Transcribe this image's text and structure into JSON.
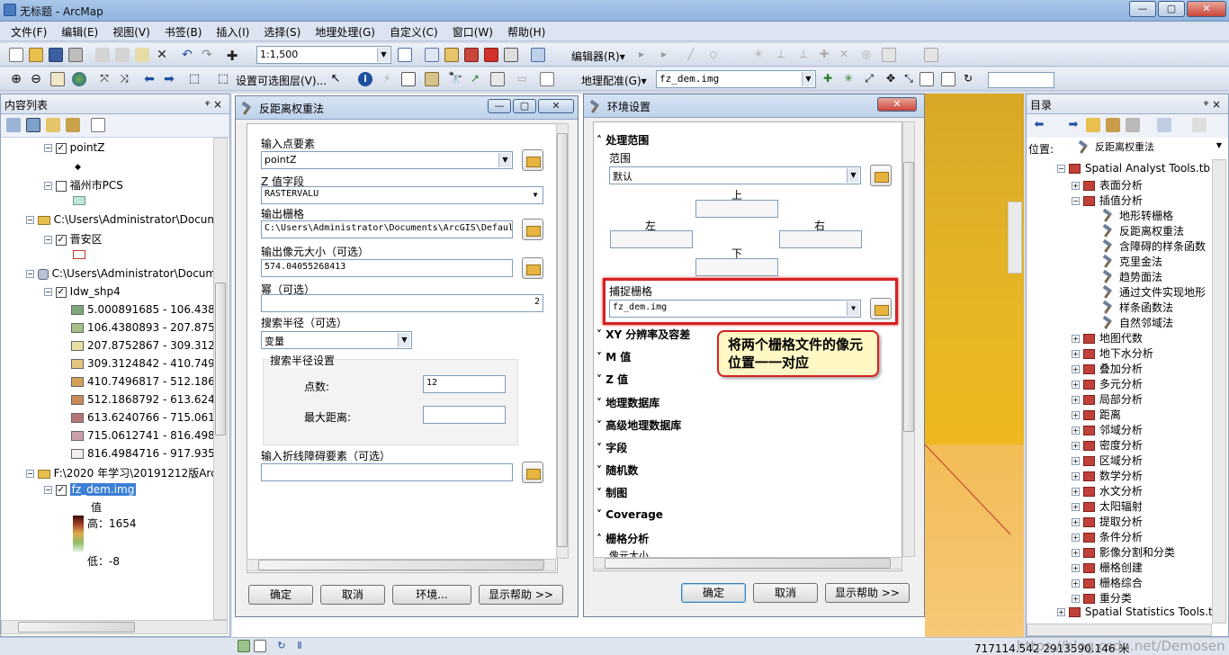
{
  "app": {
    "title": "无标题 - ArcMap"
  },
  "menu": [
    "文件(F)",
    "编辑(E)",
    "视图(V)",
    "书签(B)",
    "插入(I)",
    "选择(S)",
    "地理处理(G)",
    "自定义(C)",
    "窗口(W)",
    "帮助(H)"
  ],
  "toolbar1": {
    "scale": "1:1,500",
    "editor": "编辑器(R)▾"
  },
  "toolbar2": {
    "set_layer": "设置可选图层(V)...",
    "georef": "地理配准(G)▾",
    "georef_layer": "fz_dem.img"
  },
  "toc": {
    "title": "内容列表",
    "pin": "ᵠ ×",
    "rows": [
      "pointZ",
      "福州市PCS",
      "C:\\Users\\Administrator\\Docum",
      "晋安区",
      "C:\\Users\\Administrator\\Docum",
      "Idw_shp4",
      "F:\\2020 年学习\\20191212版Arc",
      "fz_dem.img"
    ],
    "classes": [
      {
        "label": "5.000891685 - 106.4380",
        "color": "#7fa87a"
      },
      {
        "label": "106.4380893 - 207.8752",
        "color": "#a5c185"
      },
      {
        "label": "207.8752867 - 309.3124",
        "color": "#e9dfa2"
      },
      {
        "label": "309.3124842 - 410.7496",
        "color": "#e3c580"
      },
      {
        "label": "410.7496817 - 512.1868",
        "color": "#d89f5a"
      },
      {
        "label": "512.1868792 - 613.6240",
        "color": "#c98a57"
      },
      {
        "label": "613.6240766 - 715.0612",
        "color": "#b87474"
      },
      {
        "label": "715.0612741 - 816.4984",
        "color": "#c9a0aa"
      },
      {
        "label": "816.4984716 - 917.9356",
        "color": "#f3eef0"
      }
    ],
    "value_label": "值",
    "high": "高：1654",
    "low": "低：-8"
  },
  "idw": {
    "title": "反距离权重法",
    "input_label": "输入点要素",
    "input_value": "pointZ",
    "z_label": "Z 值字段",
    "z_value": "RASTERVALU",
    "out_label": "输出栅格",
    "out_value": "C:\\Users\\Administrator\\Documents\\ArcGIS\\Defaul",
    "cell_label": "输出像元大小（可选）",
    "cell_value": "574.04055268413",
    "power_label": "幂（可选）",
    "power_value": "2",
    "radius_label": "搜索半径（可选）",
    "radius_value": "变量",
    "radius_group": "搜索半径设置",
    "points_label": "点数:",
    "points_value": "12",
    "maxdist_label": "最大距离:",
    "maxdist_value": "",
    "barrier_label": "输入折线障碍要素（可选）",
    "ok": "确定",
    "cancel": "取消",
    "env": "环境...",
    "help": "显示帮助 >>"
  },
  "env": {
    "title": "环境设置",
    "extent": "处理范围",
    "extent_label": "范围",
    "extent_value": "默认",
    "top": "上",
    "left": "左",
    "right": "右",
    "bottom": "下",
    "snap_label": "捕捉栅格",
    "snap_value": "fz_dem.img",
    "sections": [
      "XY 分辨率及容差",
      "M 值",
      "Z 值",
      "地理数据库",
      "高级地理数据库",
      "字段",
      "随机数",
      "制图",
      "Coverage",
      "栅格分析"
    ],
    "cell_size": "像元大小",
    "ok": "确定",
    "cancel": "取消",
    "help": "显示帮助 >>"
  },
  "callout": "将两个栅格文件的像元位置一一对应",
  "catalog": {
    "title": "目录",
    "location_label": "位置:",
    "location_value": "反距离权重法",
    "toolbox": "Spatial Analyst Tools.tb",
    "surface": "表面分析",
    "interp": "插值分析",
    "tools": [
      "地形转栅格",
      "反距离权重法",
      "含障碍的样条函数",
      "克里金法",
      "趋势面法",
      "通过文件实现地形",
      "样条函数法",
      "自然邻域法"
    ],
    "sets": [
      "地图代数",
      "地下水分析",
      "叠加分析",
      "多元分析",
      "局部分析",
      "距离",
      "邻域分析",
      "密度分析",
      "区域分析",
      "数学分析",
      "水文分析",
      "太阳辐射",
      "提取分析",
      "条件分析",
      "影像分割和分类",
      "栅格创建",
      "栅格综合",
      "重分类"
    ],
    "next_toolbox": "Spatial Statistics Tools.t"
  },
  "status": {
    "coords": "717114.542  2913590.146 米",
    "watermark": "https://blog.csdn.net/Demosen"
  }
}
